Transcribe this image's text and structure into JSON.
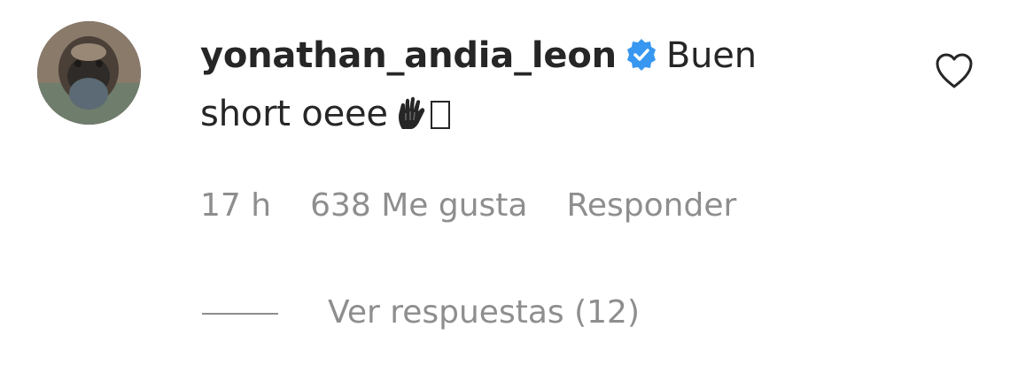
{
  "comment": {
    "username": "yonathan_andia_leon",
    "verified": true,
    "text_part1": "Buen",
    "text_part2": "short oeee",
    "emoji_icon": "raised-hand-emoji-icon",
    "time": "17 h",
    "likes": "638 Me gusta",
    "reply_label": "Responder",
    "view_replies_label": "Ver respuestas (12)",
    "like_icon": "heart-outline-icon"
  },
  "colors": {
    "text": "#262626",
    "secondary": "#8e8e8e",
    "verified_badge": "#3897f0"
  }
}
